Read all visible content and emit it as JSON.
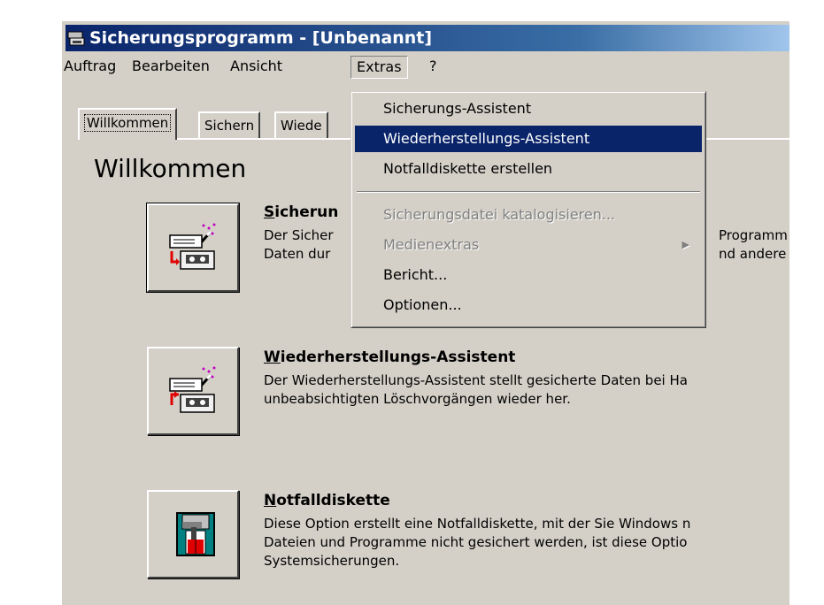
{
  "window": {
    "title": "Sicherungsprogramm - [Unbenannt]",
    "app_icon": "backup-app-icon"
  },
  "menubar": {
    "items": [
      "Auftrag",
      "Bearbeiten",
      "Ansicht",
      "Extras",
      "?"
    ],
    "open_item": "Extras"
  },
  "tabs": {
    "items": [
      "Willkommen",
      "Sichern",
      "Wiede"
    ],
    "active": "Willkommen"
  },
  "welcome": {
    "heading": "Willkommen",
    "sections": [
      {
        "title_first": "S",
        "title_rest": "icherun",
        "desc_left": "Der Sicher\nDaten dur",
        "desc_right": "Programm\nnd andere",
        "icon": "backup-wizard-icon"
      },
      {
        "title_first": "W",
        "title_rest": "iederherstellungs-Assistent",
        "desc": "Der Wiederherstellungs-Assistent stellt gesicherte Daten bei Ha\nunbeabsichtigten Löschvorgängen wieder her.",
        "icon": "restore-wizard-icon"
      },
      {
        "title_first": "N",
        "title_rest": "otfalldiskette",
        "desc": "Diese Option erstellt eine Notfalldiskette, mit der Sie Windows n\nDateien und Programme nicht gesichert werden, ist diese Optio\nSystemsicherungen.",
        "icon": "emergency-disk-icon"
      }
    ]
  },
  "dropdown": {
    "items": [
      {
        "label": "Sicherungs-Assistent",
        "state": "normal"
      },
      {
        "label": "Wiederherstellungs-Assistent",
        "state": "highlighted"
      },
      {
        "label": "Notfalldiskette erstellen",
        "state": "normal"
      },
      {
        "label": "Sicherungsdatei katalogisieren...",
        "state": "disabled"
      },
      {
        "label": "Medienextras",
        "state": "disabled",
        "submenu": true
      },
      {
        "label": "Bericht...",
        "state": "normal"
      },
      {
        "label": "Optionen...",
        "state": "normal"
      }
    ]
  },
  "colors": {
    "face": "#d4d0c8",
    "highlight": "#0a246a",
    "title_gradient_start": "#0a246a",
    "title_gradient_end": "#a6caf0",
    "disabled_text": "#808080"
  }
}
